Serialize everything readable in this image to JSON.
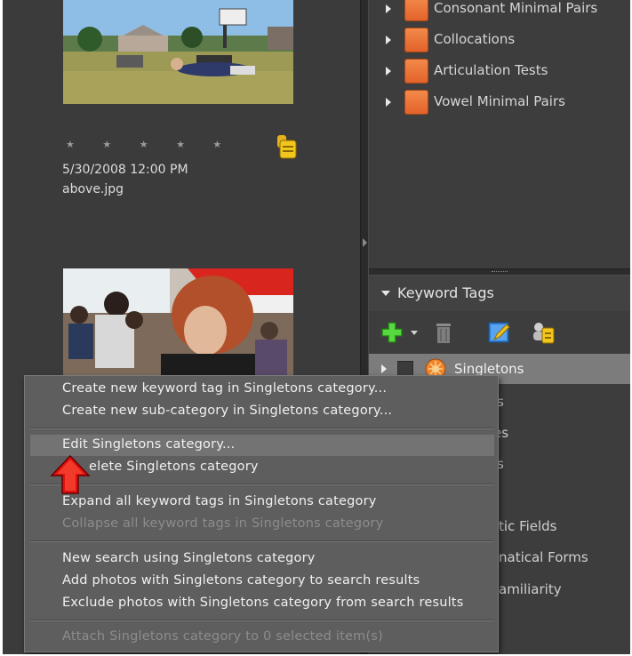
{
  "media_browser": {
    "photo1": {
      "rating": "★ ★ ★ ★ ★",
      "date": "5/30/2008 12:00 PM",
      "filename": "above.jpg"
    }
  },
  "category_tree": {
    "items": [
      {
        "label": "Consonant Minimal Pairs"
      },
      {
        "label": "Collocations"
      },
      {
        "label": "Articulation Tests"
      },
      {
        "label": "Vowel Minimal Pairs"
      }
    ]
  },
  "keyword_panel": {
    "title": "Keyword Tags",
    "selected_category": "Singletons",
    "partial_items": [
      "s",
      "es",
      "s",
      "tic Fields",
      "natical Forms",
      "amiliarity"
    ]
  },
  "context_menu": {
    "items": [
      {
        "label": "Create new keyword tag in Singletons category...",
        "enabled": true
      },
      {
        "label": "Create new sub-category in Singletons category...",
        "enabled": true
      },
      {
        "label": "Edit Singletons category...",
        "enabled": true,
        "highlighted": true
      },
      {
        "label": "elete Singletons category",
        "enabled": true
      },
      {
        "label": "Expand all keyword tags in Singletons category",
        "enabled": true
      },
      {
        "label": "Collapse all keyword tags in Singletons category",
        "enabled": false
      },
      {
        "label": "New search using Singletons category",
        "enabled": true
      },
      {
        "label": "Add photos with Singletons category to search results",
        "enabled": true
      },
      {
        "label": "Exclude photos with Singletons category from search results",
        "enabled": true
      },
      {
        "label": "Attach Singletons category to 0 selected item(s)",
        "enabled": false
      }
    ]
  },
  "colors": {
    "panel_bg": "#3d3d3d",
    "category_orange": "#ef7a3c",
    "selection_gray": "#7c7c7c",
    "menu_bg": "#5e5e5e",
    "callout_red": "#e01010",
    "add_green": "#3fbf2a"
  },
  "icons": {
    "add": "plus-icon",
    "delete": "trash-icon",
    "edit": "edit-icon",
    "people": "people-tag-icon",
    "category_badge": "category-badge-icon",
    "callout": "red-arrow-icon"
  }
}
